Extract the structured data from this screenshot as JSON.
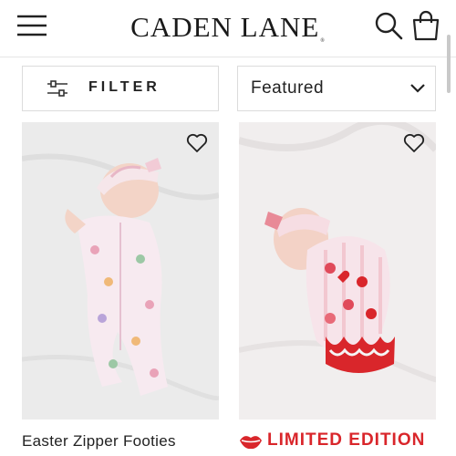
{
  "header": {
    "brand": "CADEN LANE",
    "brand_mark": "®",
    "icons": {
      "menu": "hamburger-menu-icon",
      "search": "search-icon",
      "cart": "shopping-bag-icon"
    }
  },
  "toolbar": {
    "filter_label": "FILTER",
    "filter_icon": "sliders-icon",
    "sort_value": "Featured",
    "sort_icon": "chevron-down-icon"
  },
  "products": [
    {
      "title": "Easter Zipper Footies",
      "wishlist_icon": "heart-outline-icon"
    },
    {
      "title": "LIMITED EDITION",
      "badge_icon": "lips-kiss-icon",
      "title_color": "#d9262b",
      "wishlist_icon": "heart-outline-icon"
    }
  ],
  "colors": {
    "text": "#1f1f1f",
    "accent_red": "#d9262b",
    "border": "#dcdcdc"
  }
}
